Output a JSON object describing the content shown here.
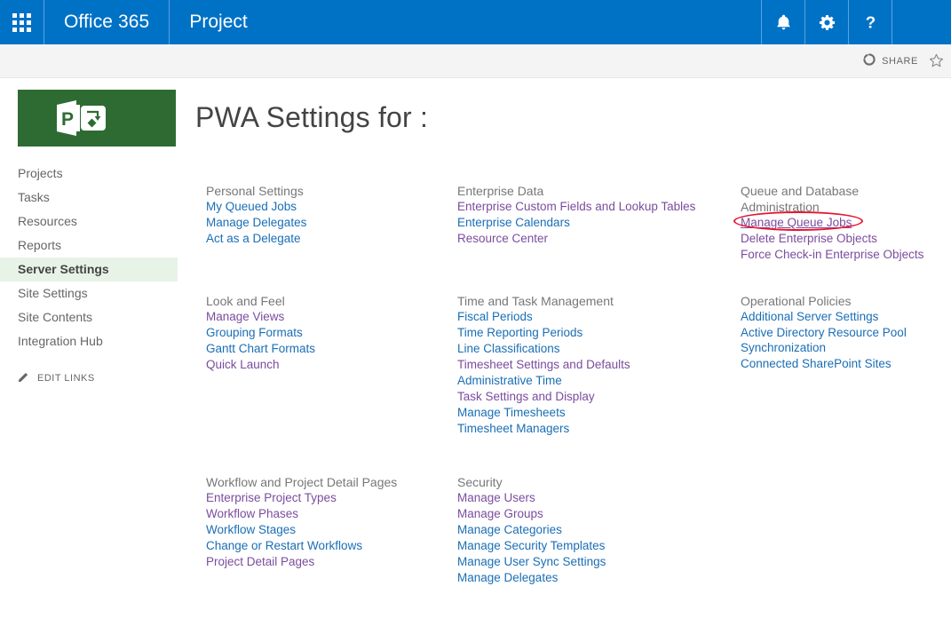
{
  "suite_bar": {
    "waffle_label": "app-launcher",
    "brand": "Office 365",
    "app_name": "Project",
    "icons": [
      {
        "name": "notifications-icon",
        "glyph": "bell"
      },
      {
        "name": "settings-gear-icon",
        "glyph": "gear"
      },
      {
        "name": "help-icon",
        "glyph": "question"
      }
    ],
    "colors": {
      "background": "#0072C6",
      "foreground": "#FFFFFF"
    }
  },
  "share_bar": {
    "share_label": "SHARE",
    "share_icon": "share-icon",
    "follow_icon": "star-icon",
    "background": "#F4F4F4"
  },
  "header": {
    "logo_alt": "Project logo",
    "logo_background": "#2E6B33",
    "title": "PWA Settings for :"
  },
  "left_nav": {
    "items": [
      {
        "label": "Projects",
        "selected": false
      },
      {
        "label": "Tasks",
        "selected": false
      },
      {
        "label": "Resources",
        "selected": false
      },
      {
        "label": "Reports",
        "selected": false
      },
      {
        "label": "Server Settings",
        "selected": true
      },
      {
        "label": "Site Settings",
        "selected": false
      },
      {
        "label": "Site Contents",
        "selected": false
      },
      {
        "label": "Integration Hub",
        "selected": false
      }
    ],
    "edit_links_label": "EDIT LINKS",
    "edit_links_icon": "pencil-icon",
    "selected_background": "#E8F3E8"
  },
  "settings": {
    "rows": [
      {
        "columns": [
          {
            "title": "Personal Settings",
            "links": [
              {
                "label": "My Queued Jobs",
                "visited": false
              },
              {
                "label": "Manage Delegates",
                "visited": false
              },
              {
                "label": "Act as a Delegate",
                "visited": false
              }
            ]
          },
          {
            "title": "Enterprise Data",
            "links": [
              {
                "label": "Enterprise Custom Fields and Lookup Tables",
                "visited": true
              },
              {
                "label": "Enterprise Calendars",
                "visited": false
              },
              {
                "label": "Resource Center",
                "visited": true
              }
            ]
          },
          {
            "title": "Queue and Database Administration",
            "links": [
              {
                "label": "Manage Queue Jobs",
                "visited": true,
                "highlighted": true
              },
              {
                "label": "Delete Enterprise Objects",
                "visited": true
              },
              {
                "label": "Force Check-in Enterprise Objects",
                "visited": true
              }
            ]
          }
        ]
      },
      {
        "columns": [
          {
            "title": "Look and Feel",
            "links": [
              {
                "label": "Manage Views",
                "visited": true
              },
              {
                "label": "Grouping Formats",
                "visited": false
              },
              {
                "label": "Gantt Chart Formats",
                "visited": false
              },
              {
                "label": "Quick Launch",
                "visited": true
              }
            ]
          },
          {
            "title": "Time and Task Management",
            "links": [
              {
                "label": "Fiscal Periods",
                "visited": false
              },
              {
                "label": "Time Reporting Periods",
                "visited": false
              },
              {
                "label": "Line Classifications",
                "visited": false
              },
              {
                "label": "Timesheet Settings and Defaults",
                "visited": true
              },
              {
                "label": "Administrative Time",
                "visited": false
              },
              {
                "label": "Task Settings and Display",
                "visited": true
              },
              {
                "label": "Manage Timesheets",
                "visited": false
              },
              {
                "label": "Timesheet Managers",
                "visited": false
              }
            ]
          },
          {
            "title": "Operational Policies",
            "links": [
              {
                "label": "Additional Server Settings",
                "visited": false
              },
              {
                "label": "Active Directory Resource Pool Synchronization",
                "visited": false
              },
              {
                "label": "Connected SharePoint Sites",
                "visited": false
              }
            ]
          }
        ]
      },
      {
        "columns": [
          {
            "title": "Workflow and Project Detail Pages",
            "links": [
              {
                "label": "Enterprise Project Types",
                "visited": true
              },
              {
                "label": "Workflow Phases",
                "visited": true
              },
              {
                "label": "Workflow Stages",
                "visited": false
              },
              {
                "label": "Change or Restart Workflows",
                "visited": false
              },
              {
                "label": "Project Detail Pages",
                "visited": true
              }
            ]
          },
          {
            "title": "Security",
            "links": [
              {
                "label": "Manage Users",
                "visited": true
              },
              {
                "label": "Manage Groups",
                "visited": true
              },
              {
                "label": "Manage Categories",
                "visited": false
              },
              {
                "label": "Manage Security Templates",
                "visited": false
              },
              {
                "label": "Manage User Sync Settings",
                "visited": false
              },
              {
                "label": "Manage Delegates",
                "visited": false
              }
            ]
          },
          {
            "title": "",
            "links": []
          }
        ]
      }
    ],
    "annotation": {
      "shape": "ellipse",
      "color": "#E8112D",
      "target": "Manage Queue Jobs"
    }
  }
}
